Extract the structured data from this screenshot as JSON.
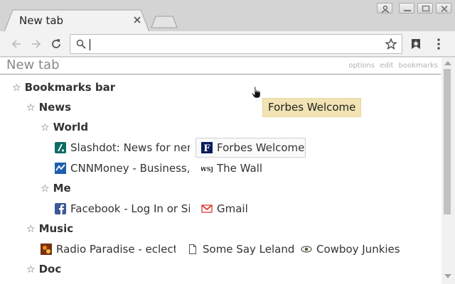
{
  "window": {
    "tab_title": "New tab"
  },
  "toolbar": {
    "omnibox_value": ""
  },
  "page": {
    "title": "New tab",
    "links": [
      "options",
      "edit",
      "bookmarks"
    ]
  },
  "tree": {
    "bookmarks_bar": "Bookmarks bar",
    "news": "News",
    "world": "World",
    "me": "Me",
    "music": "Music",
    "doc": "Doc"
  },
  "bookmarks": {
    "slashdot": "Slashdot: News for nerds, stuff that matters",
    "forbes": "Forbes Welcome",
    "cnnmoney": "CNNMoney - Business, financial and personal finance news",
    "wsj": "The Wall Street Journal",
    "facebook": "Facebook - Log In or Sign Up",
    "gmail": "Gmail",
    "radio_paradise": "Radio Paradise - eclectic online radio",
    "some_say_leland": "Some Say Leland",
    "cowboy_junkies": "Cowboy Junkies"
  },
  "tooltip": {
    "text": "Forbes Welcome"
  },
  "colors": {
    "slashdot": "#0e6b65",
    "cnn": "#1c5fae",
    "facebook": "#3b5998",
    "gmail": "#d93025",
    "forbes": "#0a1a5c"
  }
}
